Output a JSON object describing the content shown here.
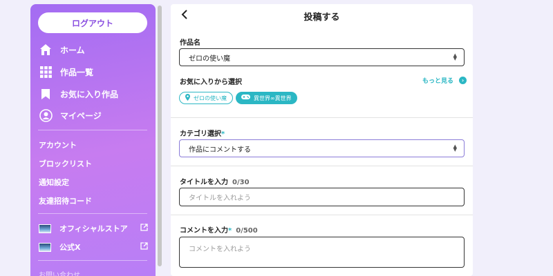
{
  "sidebar": {
    "logout_label": "ログアウト",
    "nav": [
      {
        "label": "ホーム",
        "icon": "home-icon"
      },
      {
        "label": "作品一覧",
        "icon": "grid-icon"
      },
      {
        "label": "お気に入り作品",
        "icon": "bookmark-icon"
      },
      {
        "label": "マイページ",
        "icon": "user-icon"
      }
    ],
    "sub": [
      "アカウント",
      "ブロックリスト",
      "通知設定",
      "友達招待コード"
    ],
    "external": [
      {
        "label": "オフィシャルストア",
        "icon": "external-link-icon"
      },
      {
        "label": "公式X",
        "icon": "external-link-icon"
      }
    ],
    "contact_label": "お問い合わせ"
  },
  "header": {
    "title": "投稿する",
    "back_icon": "chevron-left-icon"
  },
  "form": {
    "work": {
      "label": "作品名",
      "value": "ゼロの使い魔"
    },
    "favorites": {
      "label": "お気に入りから選択",
      "more_label": "もっと見る",
      "chips": [
        {
          "label": "ゼロの使い魔",
          "icon": "location-pin-icon"
        },
        {
          "label": "異世界∞異世界",
          "icon": "gamepad-icon"
        }
      ]
    },
    "category": {
      "label": "カテゴリ選択",
      "required_mark": "*",
      "value": "作品にコメントする"
    },
    "title_field": {
      "label": "タイトルを入力",
      "count": "0/30",
      "placeholder": "タイトルを入れよう"
    },
    "comment_field": {
      "label": "コメントを入力",
      "required_mark": "*",
      "count": "0/500",
      "placeholder": "コメントを入れよう"
    }
  },
  "colors": {
    "accent": "#2bb7c4",
    "sidebar_start": "#a36cf2",
    "sidebar_end": "#c77cf0",
    "background": "#f1effb"
  }
}
